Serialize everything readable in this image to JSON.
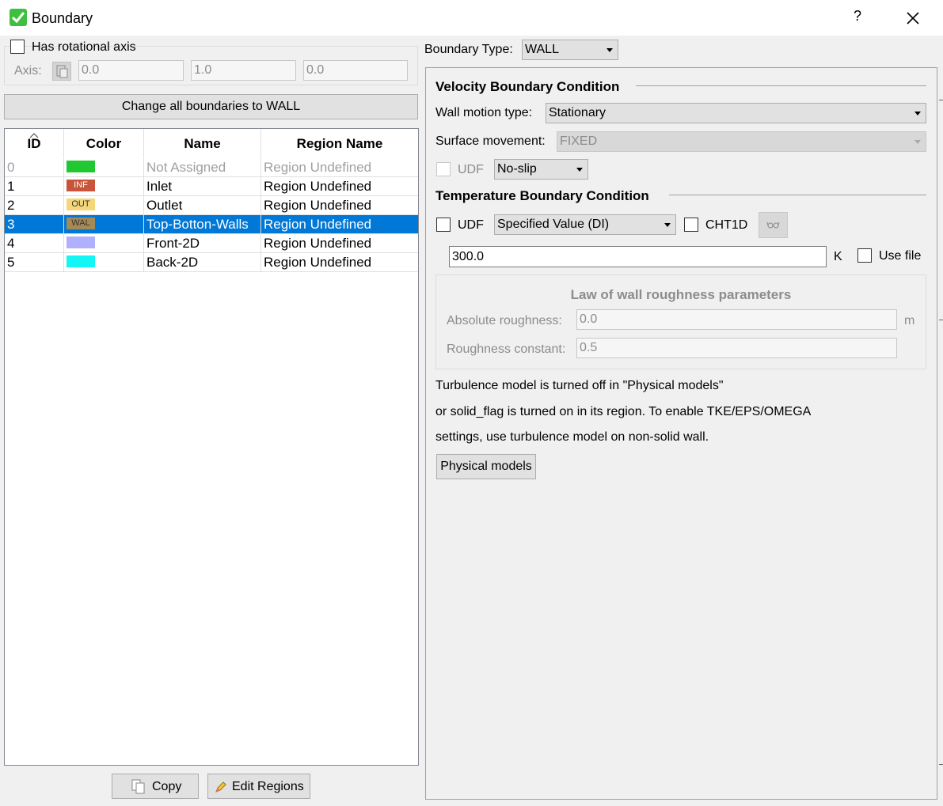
{
  "window": {
    "title": "Boundary",
    "help": "?"
  },
  "axis": {
    "has_rotational_label": "Has rotational axis",
    "axis_label": "Axis:",
    "x": "0.0",
    "y": "1.0",
    "z": "0.0"
  },
  "change_all_label": "Change all boundaries to WALL",
  "table": {
    "headers": {
      "id": "ID",
      "color": "Color",
      "name": "Name",
      "region": "Region Name"
    },
    "rows": [
      {
        "id": "0",
        "chip": "",
        "color": "#22c832",
        "name": "Not Assigned",
        "region": "Region Undefined"
      },
      {
        "id": "1",
        "chip": "INF",
        "color": "#c8553a",
        "name": "Inlet",
        "region": "Region Undefined"
      },
      {
        "id": "2",
        "chip": "OUT",
        "color": "#f5d77a",
        "name": "Outlet",
        "region": "Region Undefined"
      },
      {
        "id": "3",
        "chip": "WAL",
        "color": "#a68a55",
        "name": "Top-Botton-Walls",
        "region": "Region Undefined"
      },
      {
        "id": "4",
        "chip": "",
        "color": "#b0b0ff",
        "name": "Front-2D",
        "region": "Region Undefined"
      },
      {
        "id": "5",
        "chip": "",
        "color": "#14f5f5",
        "name": "Back-2D",
        "region": "Region Undefined"
      }
    ]
  },
  "buttons": {
    "copy": "Copy",
    "edit_regions": "Edit Regions",
    "physical_models": "Physical models"
  },
  "boundary_type": {
    "label": "Boundary Type:",
    "value": "WALL"
  },
  "velocity": {
    "title": "Velocity Boundary Condition",
    "wall_motion_label": "Wall motion type:",
    "wall_motion_value": "Stationary",
    "surface_movement_label": "Surface movement:",
    "surface_movement_value": "FIXED",
    "udf_label": "UDF",
    "slip_value": "No-slip"
  },
  "temperature": {
    "title": "Temperature Boundary Condition",
    "udf_label": "UDF",
    "mode_value": "Specified Value (DI)",
    "cht1d_label": "CHT1D",
    "value": "300.0",
    "unit": "K",
    "use_file_label": "Use file"
  },
  "roughness": {
    "title": "Law of wall roughness parameters",
    "abs_label": "Absolute roughness:",
    "abs_value": "0.0",
    "abs_unit": "m",
    "const_label": "Roughness constant:",
    "const_value": "0.5"
  },
  "turbulence_note": {
    "line1": "Turbulence model is turned off in \"Physical models\"",
    "line2": "or solid_flag is turned on in its region. To enable TKE/EPS/OMEGA",
    "line3": "settings, use turbulence model on non-solid wall."
  }
}
